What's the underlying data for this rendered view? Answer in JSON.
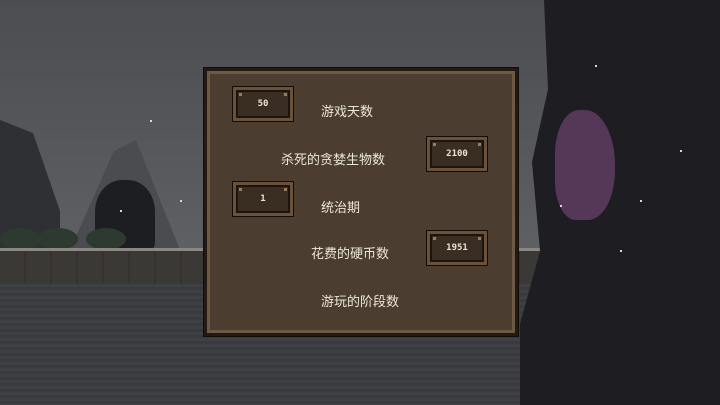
{
  "stats": [
    {
      "label": "游戏天数",
      "value": "50"
    },
    {
      "label": "杀死的贪婪生物数",
      "value": "2100"
    },
    {
      "label": "统治期",
      "value": "1"
    },
    {
      "label": "花费的硬币数",
      "value": "1951"
    },
    {
      "label": "游玩的阶段数",
      "value": ""
    }
  ],
  "colors": {
    "panel": "#4b3d30",
    "panel_border": "#6e5a44",
    "badge": "#3a2d22",
    "text": "#ece6da"
  }
}
